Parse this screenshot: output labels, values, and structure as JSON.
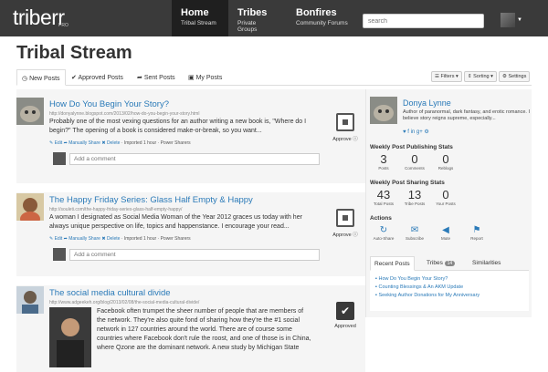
{
  "header": {
    "logo": "triberr",
    "logo_sub": "PRO",
    "nav": [
      {
        "title": "Home",
        "sub": "Tribal Stream"
      },
      {
        "title": "Tribes",
        "sub": "Private Groups"
      },
      {
        "title": "Bonfires",
        "sub": "Community Forums"
      }
    ],
    "search_placeholder": "search"
  },
  "page_title": "Tribal Stream",
  "tabs": [
    "New Posts",
    "Approved Posts",
    "Sent Posts",
    "My Posts"
  ],
  "toolbar": {
    "filters": "Filters",
    "sorting": "Sorting",
    "settings": "Settings"
  },
  "posts": [
    {
      "title": "How Do You Begin Your Story?",
      "url": "http://donyalynne.blogspot.com/2013/02/how-do-you-begin-your-story.html",
      "text": "Probably one of the most vexing questions for an author writing a new book is, \"Where do I begin?\" The opening of a book is considered make-or-break, so you want...",
      "meta_edit": "Edit",
      "meta_share": "Manually Share",
      "meta_delete": "Delete",
      "meta_info": "· Imported 1 hour · Power Sharers",
      "comment_placeholder": "Add a comment",
      "status": "Approve"
    },
    {
      "title": "The Happy Friday Series: Glass Half Empty & Happy",
      "url": "http://souleti.com/the-happy-friday-series-glass-half-empty-happy/",
      "text": "A woman I designated as Social Media Woman of the Year 2012 graces us today with her always unique perspective on life, topics and happenstance. I encourage your read...",
      "meta_edit": "Edit",
      "meta_share": "Manually Share",
      "meta_delete": "Delete",
      "meta_info": "· Imported 1 hour · Power Sharers",
      "comment_placeholder": "Add a comment",
      "status": "Approve"
    },
    {
      "title": "The social media cultural divide",
      "url": "http://www.adgeekeh.org/blog/2013/02/08/the-social-media-cultural-divide/",
      "text": "Facebook often trumpet the sheer number of people that are members of the network. They're also quite fond of sharing how they're the #1 social network in 127 countries around the world. There are of course some countries where Facebook don't rule the roost, and one of those is in China, where Qzone are the dominant network. A new study by Michigan State",
      "status": "Approved"
    }
  ],
  "sidebar": {
    "name": "Donya Lynne",
    "bio": "Author of paranormal, dark fantasy, and erotic romance. I believe story reigns supreme, especially...",
    "social": "♥ f in g+ ⚙",
    "publishing_heading": "Weekly Post Publishing Stats",
    "publishing": [
      {
        "num": "3",
        "label": "Posts"
      },
      {
        "num": "0",
        "label": "Comments"
      },
      {
        "num": "0",
        "label": "Reblogs"
      }
    ],
    "sharing_heading": "Weekly Post Sharing Stats",
    "sharing": [
      {
        "num": "43",
        "label": "Total Posts"
      },
      {
        "num": "13",
        "label": "Tribe Posts"
      },
      {
        "num": "0",
        "label": "Your Posts"
      }
    ],
    "actions_heading": "Actions",
    "actions": [
      {
        "icon": "↻",
        "label": "Auto-Share"
      },
      {
        "icon": "✉",
        "label": "Subscribe"
      },
      {
        "icon": "◀",
        "label": "Mute"
      },
      {
        "icon": "⚑",
        "label": "Report"
      }
    ],
    "tabs": {
      "recent": "Recent Posts",
      "tribes": "Tribes",
      "tribes_count": "14",
      "similarities": "Similarities"
    },
    "recent_posts": [
      "How Do You Begin Your Story?",
      "Counting Blessings & An AKM Update",
      "Seeking Author Donations for My Anniversary"
    ]
  }
}
